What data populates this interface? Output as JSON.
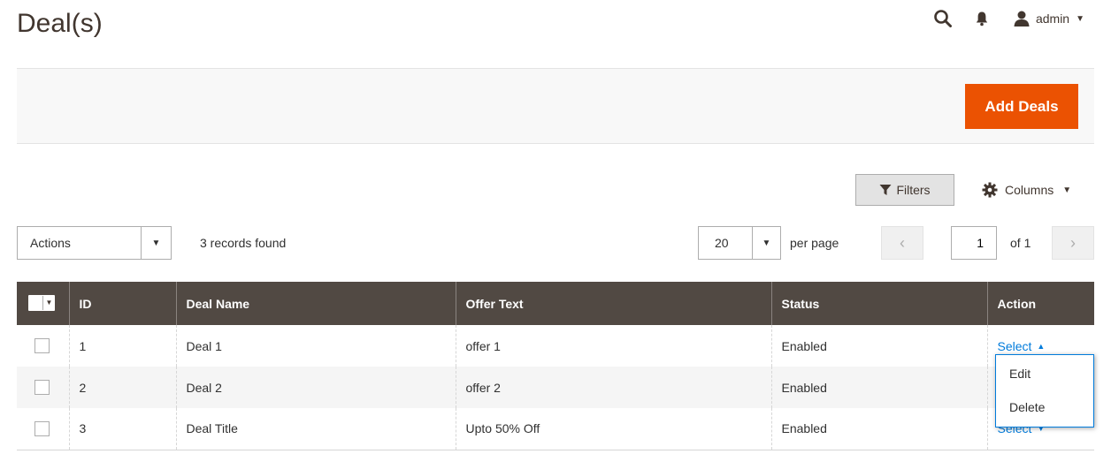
{
  "page": {
    "title": "Deal(s)"
  },
  "admin_bar": {
    "search_icon": "search-icon",
    "notifications_icon": "bell-icon",
    "user_label": "admin"
  },
  "toolbar": {
    "add_label": "Add Deals",
    "filters_label": "Filters",
    "columns_label": "Columns"
  },
  "grid_controls": {
    "actions_label": "Actions",
    "records_found": "3 records found",
    "per_page_value": "20",
    "per_page_label": "per page",
    "current_page": "1",
    "total_pages_label": "of 1"
  },
  "grid": {
    "headers": [
      "ID",
      "Deal Name",
      "Offer Text",
      "Status",
      "Action"
    ],
    "rows": [
      {
        "id": "1",
        "name": "Deal 1",
        "offer": "offer 1",
        "status": "Enabled",
        "action": "Select"
      },
      {
        "id": "2",
        "name": "Deal 2",
        "offer": "offer 2",
        "status": "Enabled",
        "action": ""
      },
      {
        "id": "3",
        "name": "Deal Title",
        "offer": "Upto 50% Off",
        "status": "Enabled",
        "action": "Select"
      }
    ]
  },
  "action_menu": {
    "items": [
      "Edit",
      "Delete"
    ]
  },
  "colors": {
    "accent": "#eb5202",
    "header_bg": "#514943",
    "link": "#007bdb"
  }
}
